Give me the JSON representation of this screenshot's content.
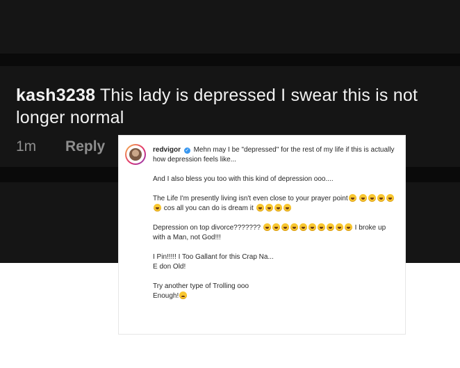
{
  "comment": {
    "username": "kash3238",
    "text": "This lady is depressed I swear this is not longer normal",
    "time": "1m",
    "reply_label": "Reply"
  },
  "reply": {
    "username": "redvigor",
    "verified_icon": "verified-badge-icon",
    "line1": "Mehn may I be \"depressed\" for the rest of my life if this is actually how depression feels like...",
    "line2": "And I also bless you too with this kind of depression ooo....",
    "line3a": "The Life I'm presently living isn't even close to your prayer point",
    "line3b": "cos all you can do is dream it",
    "line4a": "Depression on top divorce???????",
    "line4b": "I broke up with a Man, not God!!!",
    "line5a": "I Pin!!!!! I Too Gallant for this Crap Na...",
    "line5b": "E don Old!",
    "line6a": "Try another type of Trolling ooo",
    "line6b": "Enough!",
    "emoji_laugh": "face-with-tears-of-joy-emoji",
    "emoji_sad": "disappointed-face-emoji"
  }
}
